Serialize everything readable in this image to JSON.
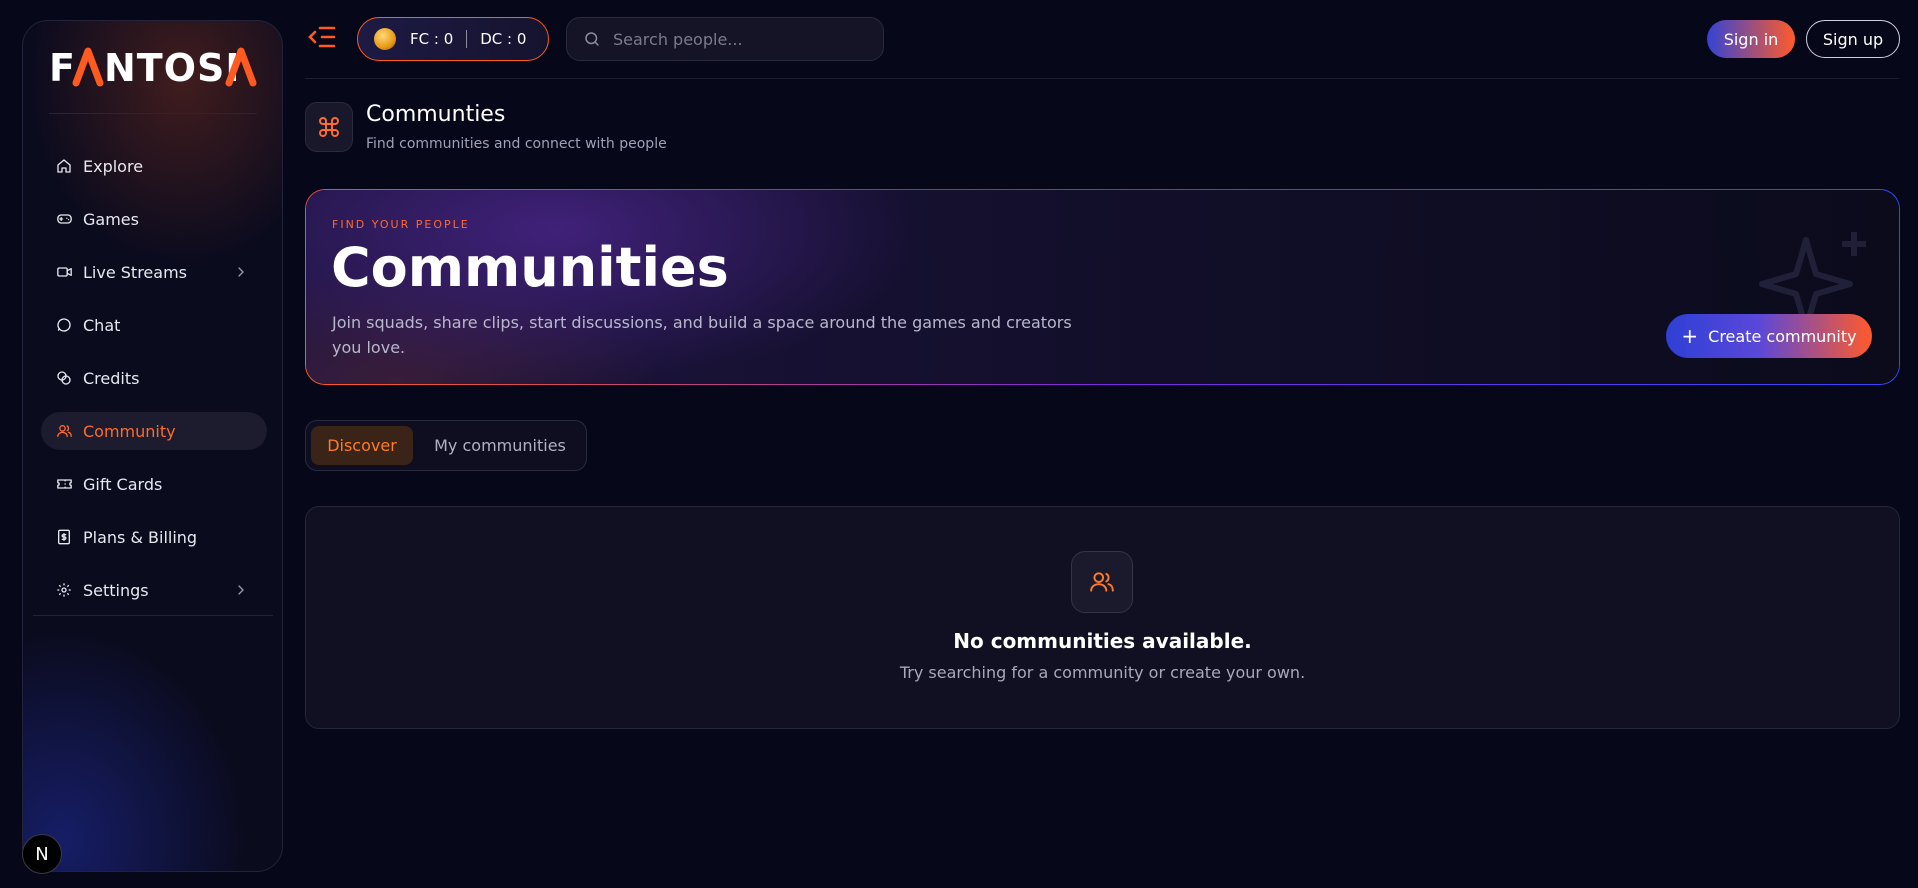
{
  "brand": {
    "logo_text": "FANTOSIA",
    "accent": "#ff5a1f"
  },
  "sidebar": {
    "items": [
      {
        "label": "Explore",
        "icon": "home-icon",
        "active": false,
        "has_submenu": false
      },
      {
        "label": "Games",
        "icon": "gamepad-icon",
        "active": false,
        "has_submenu": false
      },
      {
        "label": "Live Streams",
        "icon": "video-icon",
        "active": false,
        "has_submenu": true
      },
      {
        "label": "Chat",
        "icon": "chat-bubble-icon",
        "active": false,
        "has_submenu": false
      },
      {
        "label": "Credits",
        "icon": "coins-icon",
        "active": false,
        "has_submenu": false
      },
      {
        "label": "Community",
        "icon": "users-icon",
        "active": true,
        "has_submenu": false
      },
      {
        "label": "Gift Cards",
        "icon": "ticket-icon",
        "active": false,
        "has_submenu": false
      },
      {
        "label": "Plans & Billing",
        "icon": "receipt-dollar-icon",
        "active": false,
        "has_submenu": false
      },
      {
        "label": "Settings",
        "icon": "gear-icon",
        "active": false,
        "has_submenu": true
      }
    ],
    "badge_letter": "N"
  },
  "header": {
    "credits": {
      "fc_label": "FC : 0",
      "dc_label": "DC : 0"
    },
    "search": {
      "placeholder": "Search people..."
    },
    "signin_label": "Sign in",
    "signup_label": "Sign up"
  },
  "page": {
    "title": "Communties",
    "subtitle": "Find communities and connect with people",
    "icon": "command-icon"
  },
  "hero": {
    "eyebrow": "FIND YOUR PEOPLE",
    "title": "Communities",
    "description": "Join squads, share clips, start discussions, and build a space around the games and creators you love.",
    "cta_label": "Create community"
  },
  "tabs": [
    {
      "label": "Discover",
      "active": true
    },
    {
      "label": "My communities",
      "active": false
    }
  ],
  "empty_state": {
    "title": "No communities available.",
    "description": "Try searching for a community or create your own."
  }
}
